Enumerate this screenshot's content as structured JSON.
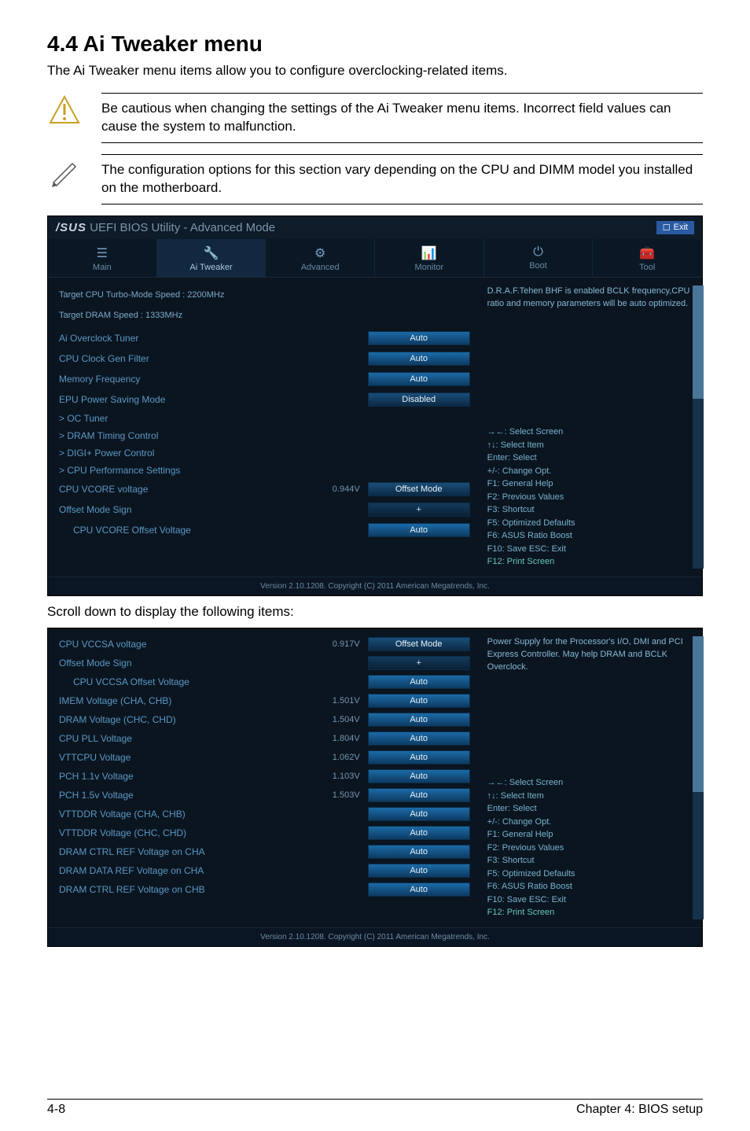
{
  "heading": "4.4    Ai Tweaker menu",
  "subtitle": "The Ai Tweaker menu items allow you to configure overclocking-related items.",
  "note1": "Be cautious when changing the settings of the Ai Tweaker menu items. Incorrect field values can cause the system to malfunction.",
  "note2": "The configuration options for this section vary depending on the CPU and DIMM model you installed on the motherboard.",
  "bios": {
    "brand": "/SUS",
    "title": "UEFI BIOS Utility - Advanced Mode",
    "exit": "Exit",
    "tabs": [
      "Main",
      "Ai Tweaker",
      "Advanced",
      "Monitor",
      "Boot",
      "Tool"
    ],
    "target1": "Target CPU Turbo-Mode Speed : 2200MHz",
    "target2": "Target DRAM Speed : 1333MHz",
    "rows1": [
      {
        "label": "Ai Overclock Tuner",
        "field": "Auto"
      },
      {
        "label": "CPU Clock Gen Filter",
        "field": "Auto"
      },
      {
        "label": "Memory Frequency",
        "field": "Auto"
      },
      {
        "label": "EPU Power Saving Mode",
        "field": "Disabled"
      }
    ],
    "subs1": [
      "> OC Tuner",
      "> DRAM Timing Control",
      "> DIGI+ Power Control",
      "> CPU Performance Settings"
    ],
    "rows1b": [
      {
        "label": "CPU VCORE voltage",
        "num": "0.944V",
        "field": "Offset Mode"
      },
      {
        "label": "Offset Mode Sign",
        "num": "",
        "field": "+"
      },
      {
        "label": "CPU VCORE Offset Voltage",
        "num": "",
        "field": "Auto",
        "indent": true
      }
    ],
    "info1": "D.R.A.F.Tehen BHF is enabled BCLK frequency,CPU ratio and memory parameters will be auto optimized.",
    "help_title": "→←: Select Screen",
    "help_lines": [
      "↑↓: Select Item",
      "Enter: Select",
      "+/-: Change Opt.",
      "F1: General Help",
      "F2: Previous Values",
      "F3: Shortcut",
      "F5: Optimized Defaults",
      "F6: ASUS Ratio Boost",
      "F10: Save  ESC: Exit"
    ],
    "help_last": "F12: Print Screen",
    "footer": "Version 2.10.1208. Copyright (C) 2011 American Megatrends, Inc."
  },
  "caption": "Scroll down to display the following items:",
  "bios2": {
    "rows": [
      {
        "label": "CPU VCCSA voltage",
        "num": "0.917V",
        "field": "Offset Mode"
      },
      {
        "label": "Offset Mode Sign",
        "num": "",
        "field": "+"
      },
      {
        "label": "CPU VCCSA Offset Voltage",
        "num": "",
        "field": "Auto",
        "indent": true
      },
      {
        "label": "IMEM Voltage (CHA, CHB)",
        "num": "1.501V",
        "field": "Auto"
      },
      {
        "label": "DRAM Voltage (CHC, CHD)",
        "num": "1.504V",
        "field": "Auto"
      },
      {
        "label": "CPU PLL Voltage",
        "num": "1.804V",
        "field": "Auto"
      },
      {
        "label": "VTTCPU Voltage",
        "num": "1.062V",
        "field": "Auto"
      },
      {
        "label": "PCH 1.1v Voltage",
        "num": "1.103V",
        "field": "Auto"
      },
      {
        "label": "PCH 1.5v Voltage",
        "num": "1.503V",
        "field": "Auto"
      },
      {
        "label": "VTTDDR Voltage (CHA, CHB)",
        "num": "",
        "field": "Auto"
      },
      {
        "label": "VTTDDR Voltage (CHC, CHD)",
        "num": "",
        "field": "Auto"
      },
      {
        "label": "DRAM CTRL REF Voltage on CHA",
        "num": "",
        "field": "Auto"
      },
      {
        "label": "DRAM DATA REF Voltage on CHA",
        "num": "",
        "field": "Auto"
      },
      {
        "label": "DRAM CTRL REF Voltage on CHB",
        "num": "",
        "field": "Auto"
      }
    ],
    "info": "Power Supply for the Processor's I/O, DMI and PCI Express Controller. May help DRAM and BCLK Overclock.",
    "footer": "Version 2.10.1208. Copyright (C) 2011 American Megatrends, Inc."
  },
  "page_footer_left": "4-8",
  "page_footer_right": "Chapter 4: BIOS setup"
}
